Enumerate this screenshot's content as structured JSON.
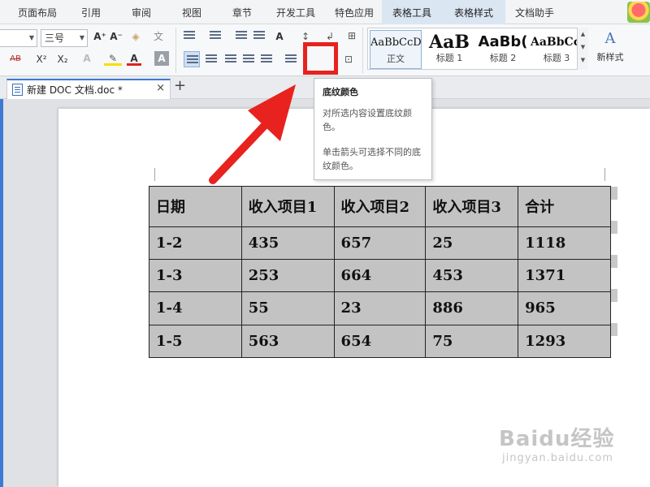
{
  "menu": {
    "tabs": [
      "页面布局",
      "引用",
      "审阅",
      "视图",
      "章节",
      "开发工具",
      "特色应用",
      "表格工具",
      "表格样式",
      "文档助手"
    ]
  },
  "ribbon": {
    "font_size": "三号",
    "styles": [
      {
        "sample": "AaBbCcD",
        "name": "正文"
      },
      {
        "sample": "AaB",
        "name": "标题 1"
      },
      {
        "sample": "AaBb(",
        "name": "标题 2"
      },
      {
        "sample": "AaBbCcl",
        "name": "标题 3"
      }
    ],
    "new_style_label": "新样式",
    "icons": {
      "grow_font": "A⁺",
      "shrink_font": "A⁻",
      "pinyin": "文",
      "strikethrough": "AB",
      "superscript": "X²",
      "subscript": "X₂",
      "font_color": "A",
      "char_shading": "A"
    }
  },
  "doc_tab": {
    "title": "新建 DOC 文档.doc *"
  },
  "tooltip": {
    "title": "底纹颜色",
    "line1": "对所选内容设置底纹颜色。",
    "line2": "单击箭头可选择不同的底纹颜色。"
  },
  "table": {
    "header": [
      "日期",
      "收入项目1",
      "收入项目2",
      "收入项目3",
      "合计"
    ],
    "rows": [
      [
        "1-2",
        "435",
        "657",
        "25",
        "1118"
      ],
      [
        "1-3",
        "253",
        "664",
        "453",
        "1371"
      ],
      [
        "1-4",
        "55",
        "23",
        "886",
        "965"
      ],
      [
        "1-5",
        "563",
        "654",
        "75",
        "1293"
      ]
    ]
  },
  "watermark": {
    "brand": "Baidu经验",
    "url": "jingyan.baidu.com"
  },
  "colors": {
    "highlight": "#e8221e",
    "table_fill": "#c3c3c3",
    "accent": "#3e7ad3"
  }
}
